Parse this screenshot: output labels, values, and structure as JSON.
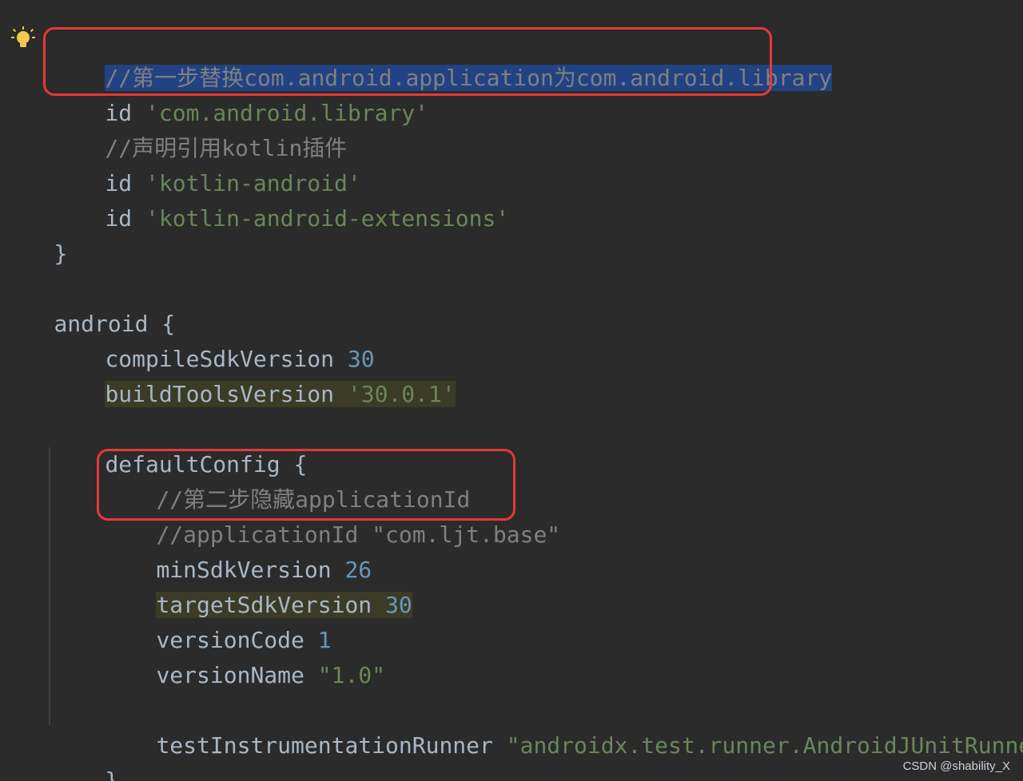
{
  "code": {
    "l1_comment": "//第一步替换com.android.application为com.android.library",
    "l2_kw": "id ",
    "l2_str": "'com.android.library'",
    "l3_comment": "//声明引用kotlin插件",
    "l4_kw": "id ",
    "l4_str": "'kotlin-android'",
    "l5_kw": "id ",
    "l5_str": "'kotlin-android-extensions'",
    "l6_close": "}",
    "l8_open": "android {",
    "l9_kw": "compileSdkVersion ",
    "l9_num": "30",
    "l10_kw": "buildToolsVersion ",
    "l10_str": "'30.0.1'",
    "l12_open": "defaultConfig {",
    "l13_comment": "//第二步隐藏applicationId",
    "l14_comment": "//applicationId \"com.ljt.base\"",
    "l15_kw": "minSdkVersion ",
    "l15_num": "26",
    "l16_kw": "targetSdkVersion ",
    "l16_num": "30",
    "l17_kw": "versionCode ",
    "l17_num": "1",
    "l18_kw": "versionName ",
    "l18_str": "\"1.0\"",
    "l20_kw": "testInstrumentationRunner ",
    "l20_str": "\"androidx.test.runner.AndroidJUnitRunner\"",
    "l21_close": "}"
  },
  "icons": {
    "intention": "lightbulb-icon"
  },
  "colors": {
    "background": "#2b2b2b",
    "comment": "#808080",
    "string": "#6a8759",
    "number": "#6897bb",
    "text": "#a9b7c6",
    "selection": "#214283",
    "annotation": "#e53935"
  },
  "watermark": "CSDN @shability_X"
}
